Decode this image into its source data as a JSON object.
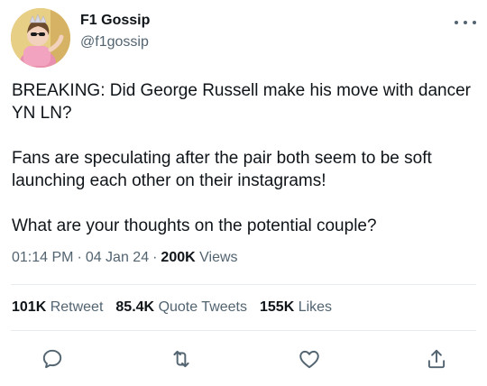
{
  "author": {
    "display_name": "F1 Gossip",
    "handle": "@f1gossip"
  },
  "tweet": {
    "paragraphs": [
      "BREAKING: Did George Russell make his move with dancer YN LN?",
      "Fans are speculating after the pair both seem to be soft launching each other on their instagrams!",
      "What are your thoughts on the potential couple?"
    ]
  },
  "meta": {
    "time": "01:14 PM",
    "date": "04 Jan 24",
    "views_count": "200K",
    "views_label": "Views"
  },
  "stats": {
    "retweets_count": "101K",
    "retweets_label": "Retweet",
    "quotes_count": "85.4K",
    "quotes_label": "Quote Tweets",
    "likes_count": "155K",
    "likes_label": "Likes"
  },
  "actions": {
    "icons": [
      "reply-icon",
      "retweet-icon",
      "like-icon",
      "share-icon"
    ]
  },
  "colors": {
    "text_primary": "#0f1419",
    "text_secondary": "#536471",
    "divider": "#e6ecf0"
  }
}
